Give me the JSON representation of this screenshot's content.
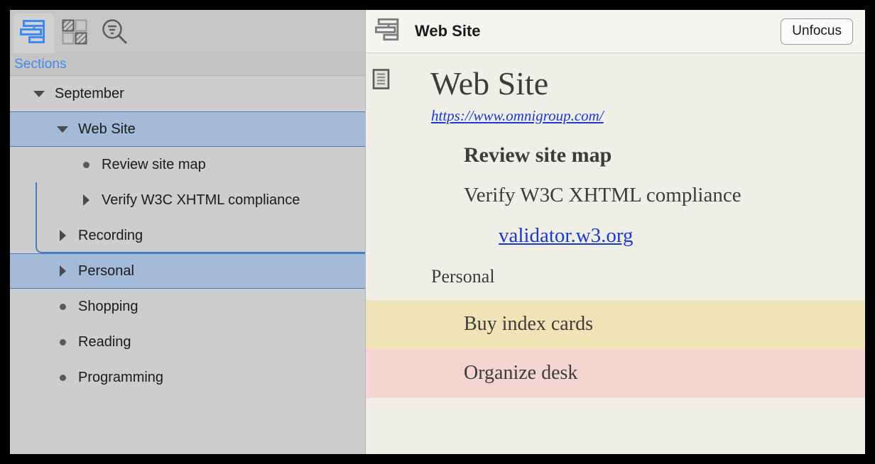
{
  "window": {
    "title": "Web Site"
  },
  "sidebar": {
    "toolbar": {
      "tabs": [
        {
          "icon": "sections-outline-icon",
          "name": "sections-tab",
          "active": true
        },
        {
          "icon": "checkerboard-grid-icon",
          "name": "styles-tab",
          "active": false
        },
        {
          "icon": "search-filter-icon",
          "name": "search-tab",
          "active": false
        }
      ]
    },
    "header_label": "Sections",
    "tree": [
      {
        "label": "September",
        "marker": "triangle-down",
        "indent": 0,
        "selected": false
      },
      {
        "label": "Web Site",
        "marker": "triangle-down",
        "indent": 1,
        "selected": true
      },
      {
        "label": "Review site map",
        "marker": "bullet",
        "indent": 2,
        "selected": false
      },
      {
        "label": "Verify W3C XHTML compliance",
        "marker": "triangle-right",
        "indent": 2,
        "selected": false
      },
      {
        "label": "Recording",
        "marker": "triangle-right",
        "indent": 1,
        "selected": false
      },
      {
        "label": "Personal",
        "marker": "triangle-right",
        "indent": 1,
        "selected": true
      },
      {
        "label": "Shopping",
        "marker": "bullet",
        "indent": 1,
        "selected": false
      },
      {
        "label": "Reading",
        "marker": "bullet",
        "indent": 1,
        "selected": false
      },
      {
        "label": "Programming",
        "marker": "bullet",
        "indent": 1,
        "selected": false
      }
    ]
  },
  "detail": {
    "header": {
      "icon": "sections-outline-icon",
      "title": "Web Site",
      "unfocus_label": "Unfocus"
    },
    "document": {
      "icon": "document-page-icon",
      "title": "Web Site",
      "url": "https://www.omnigroup.com/",
      "heading": "Review site map",
      "paragraph": "Verify W3C XHTML compliance",
      "link": "validator.w3.org",
      "section": "Personal",
      "highlighted_rows": [
        {
          "label": "Buy index cards",
          "color": "#f0e3b8"
        },
        {
          "label": "Organize desk",
          "color": "#f4d5d2"
        }
      ]
    }
  },
  "colors": {
    "selection_blue": "#a3bad8",
    "selection_border": "#4a7ec4",
    "accent_link": "#1a37d8",
    "sections_label": "#3d8bf2",
    "doc_background": "#f0efe7",
    "sidebar_background": "#cdcdcd",
    "highlight_tan": "#f0e3b8",
    "highlight_pink": "#f4d5d2"
  }
}
